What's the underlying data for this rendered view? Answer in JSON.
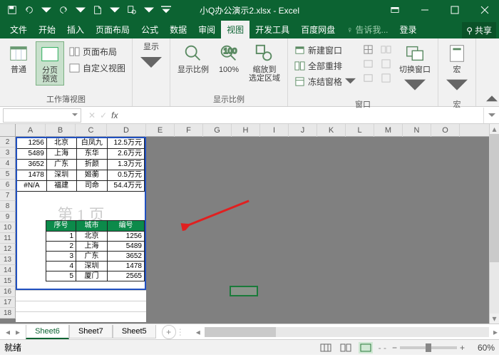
{
  "title": "小Q办公演示2.xlsx - Excel",
  "tabs": {
    "file": "文件",
    "home": "开始",
    "insert": "插入",
    "layout": "页面布局",
    "formulas": "公式",
    "data": "数据",
    "review": "审阅",
    "view": "视图",
    "dev": "开发工具",
    "baidu": "百度网盘",
    "tell": "告诉我...",
    "login": "登录",
    "share": "共享"
  },
  "ribbon": {
    "g1": {
      "normal": "普通",
      "pagebreak": "分页\n预览",
      "pagelayout": "页面布局",
      "custom": "自定义视图",
      "label": "工作簿视图"
    },
    "g2": {
      "show": "显示",
      "label": ""
    },
    "g3": {
      "zoom": "显示比例",
      "hundred": "100%",
      "zoomsel": "缩放到\n选定区域",
      "label": "显示比例"
    },
    "g4": {
      "newwin": "新建窗口",
      "arrange": "全部重排",
      "freeze": "冻结窗格",
      "switch": "切换窗口",
      "label": "窗口"
    },
    "g5": {
      "macro": "宏",
      "label": "宏"
    }
  },
  "chart_data": {
    "type": "table",
    "tables": [
      {
        "name": "upper",
        "columns": [
          "A",
          "B",
          "C",
          "D"
        ],
        "rows": [
          [
            "1256",
            "北京",
            "白凤九",
            "12.5万元"
          ],
          [
            "5489",
            "上海",
            "东华",
            "2.6万元"
          ],
          [
            "3652",
            "广东",
            "折颜",
            "1.3万元"
          ],
          [
            "1478",
            "深圳",
            "姬蘅",
            "0.5万元"
          ],
          [
            "#N/A",
            "福建",
            "司命",
            "54.4万元"
          ]
        ]
      },
      {
        "name": "lower",
        "headers": [
          "序号",
          "城市",
          "编号"
        ],
        "rows": [
          [
            "1",
            "北京",
            "1256"
          ],
          [
            "2",
            "上海",
            "5489"
          ],
          [
            "3",
            "广东",
            "3652"
          ],
          [
            "4",
            "深圳",
            "1478"
          ],
          [
            "5",
            "厦门",
            "2565"
          ]
        ]
      }
    ],
    "watermark": "第 1 页"
  },
  "sheets": {
    "s6": "Sheet6",
    "s7": "Sheet7",
    "s5": "Sheet5"
  },
  "colheads": [
    "A",
    "B",
    "C",
    "D",
    "E",
    "F",
    "G",
    "H",
    "I",
    "J",
    "K",
    "L",
    "M",
    "N",
    "O"
  ],
  "status": {
    "ready": "就绪",
    "zoom": "60%"
  }
}
